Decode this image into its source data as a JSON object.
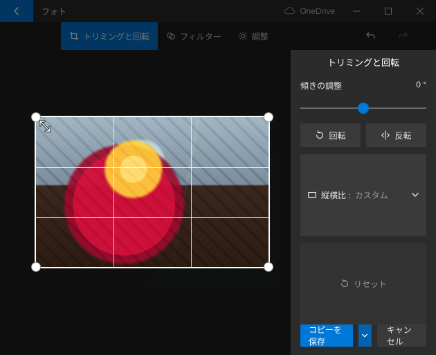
{
  "titlebar": {
    "app_name": "フォト",
    "cloud_label": "OneDrive"
  },
  "tabs": {
    "crop_rotate": "トリミングと回転",
    "filters": "フィルター",
    "adjust": "調整"
  },
  "panel": {
    "title": "トリミングと回転",
    "straighten_label": "傾きの調整",
    "straighten_value": "0 °",
    "rotate_label": "回転",
    "flip_label": "反転",
    "aspect_label": "縦横比 :",
    "aspect_value": "カスタム",
    "reset_label": "リセット"
  },
  "actions": {
    "save_copy": "コピーを保存",
    "cancel": "キャンセル"
  },
  "slider": {
    "position_pct": 50
  }
}
